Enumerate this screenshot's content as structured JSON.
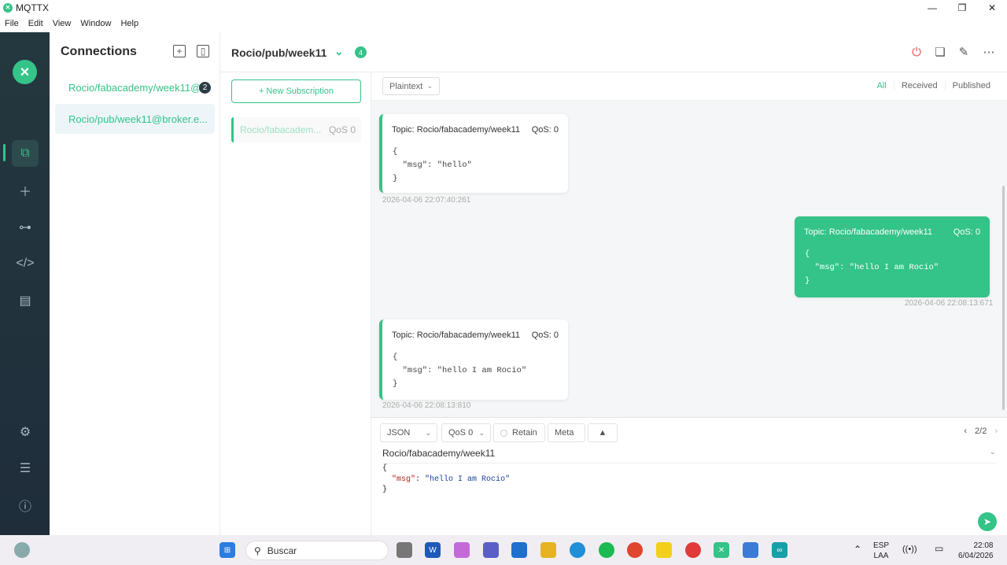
{
  "window": {
    "title": "MQTTX",
    "minimize": "—",
    "maximize": "❐",
    "close": "✕"
  },
  "menu": [
    "File",
    "Edit",
    "View",
    "Window",
    "Help"
  ],
  "connections": {
    "title": "Connections",
    "items": [
      {
        "label": "Rocio/fabacademy/week11@...",
        "badge": "2"
      },
      {
        "label": "Rocio/pub/week11@broker.e..."
      }
    ]
  },
  "header": {
    "title": "Rocio/pub/week11",
    "count": "4"
  },
  "subscriptions": {
    "new_label": "+ New Subscription",
    "items": [
      {
        "topic": "Rocio/fabacadem...",
        "qos": "QoS 0"
      }
    ]
  },
  "message_filter": {
    "format": "Plaintext",
    "tabs": [
      "All",
      "Received",
      "Published"
    ]
  },
  "messages": [
    {
      "direction": "received",
      "topic": "Topic: Rocio/fabacademy/week11",
      "qos": "QoS: 0",
      "l1": "{",
      "l2": "  \"msg\": \"hello\"",
      "l3": "}",
      "time": "2026-04-06 22:07:40:261"
    },
    {
      "direction": "published",
      "topic": "Topic: Rocio/fabacademy/week11",
      "qos": "QoS: 0",
      "l1": "{",
      "l2": "  \"msg\": \"hello I am Rocio\"",
      "l3": "}",
      "time": "2026-04-06 22:08:13:671"
    },
    {
      "direction": "received",
      "topic": "Topic: Rocio/fabacademy/week11",
      "qos": "QoS: 0",
      "l1": "{",
      "l2": "  \"msg\": \"hello I am Rocio\"",
      "l3": "}",
      "time": "2026-04-06 22:08:13:810"
    }
  ],
  "composer": {
    "format": "JSON",
    "qos": "QoS 0",
    "retain": "Retain",
    "meta": "Meta",
    "pager": "2/2",
    "topic": "Rocio/fabacademy/week11",
    "code_open": "{",
    "code_key": "\"msg\"",
    "code_colon": ": ",
    "code_value": "\"hello I am Rocio\"",
    "code_close": "}"
  },
  "taskbar": {
    "search_placeholder": "Buscar",
    "lang_top": "ESP",
    "lang_bottom": "LAA",
    "time": "22:08",
    "date": "6/04/2026"
  },
  "colors": {
    "accent": "#34c388",
    "rail": "#1f2d3b"
  }
}
